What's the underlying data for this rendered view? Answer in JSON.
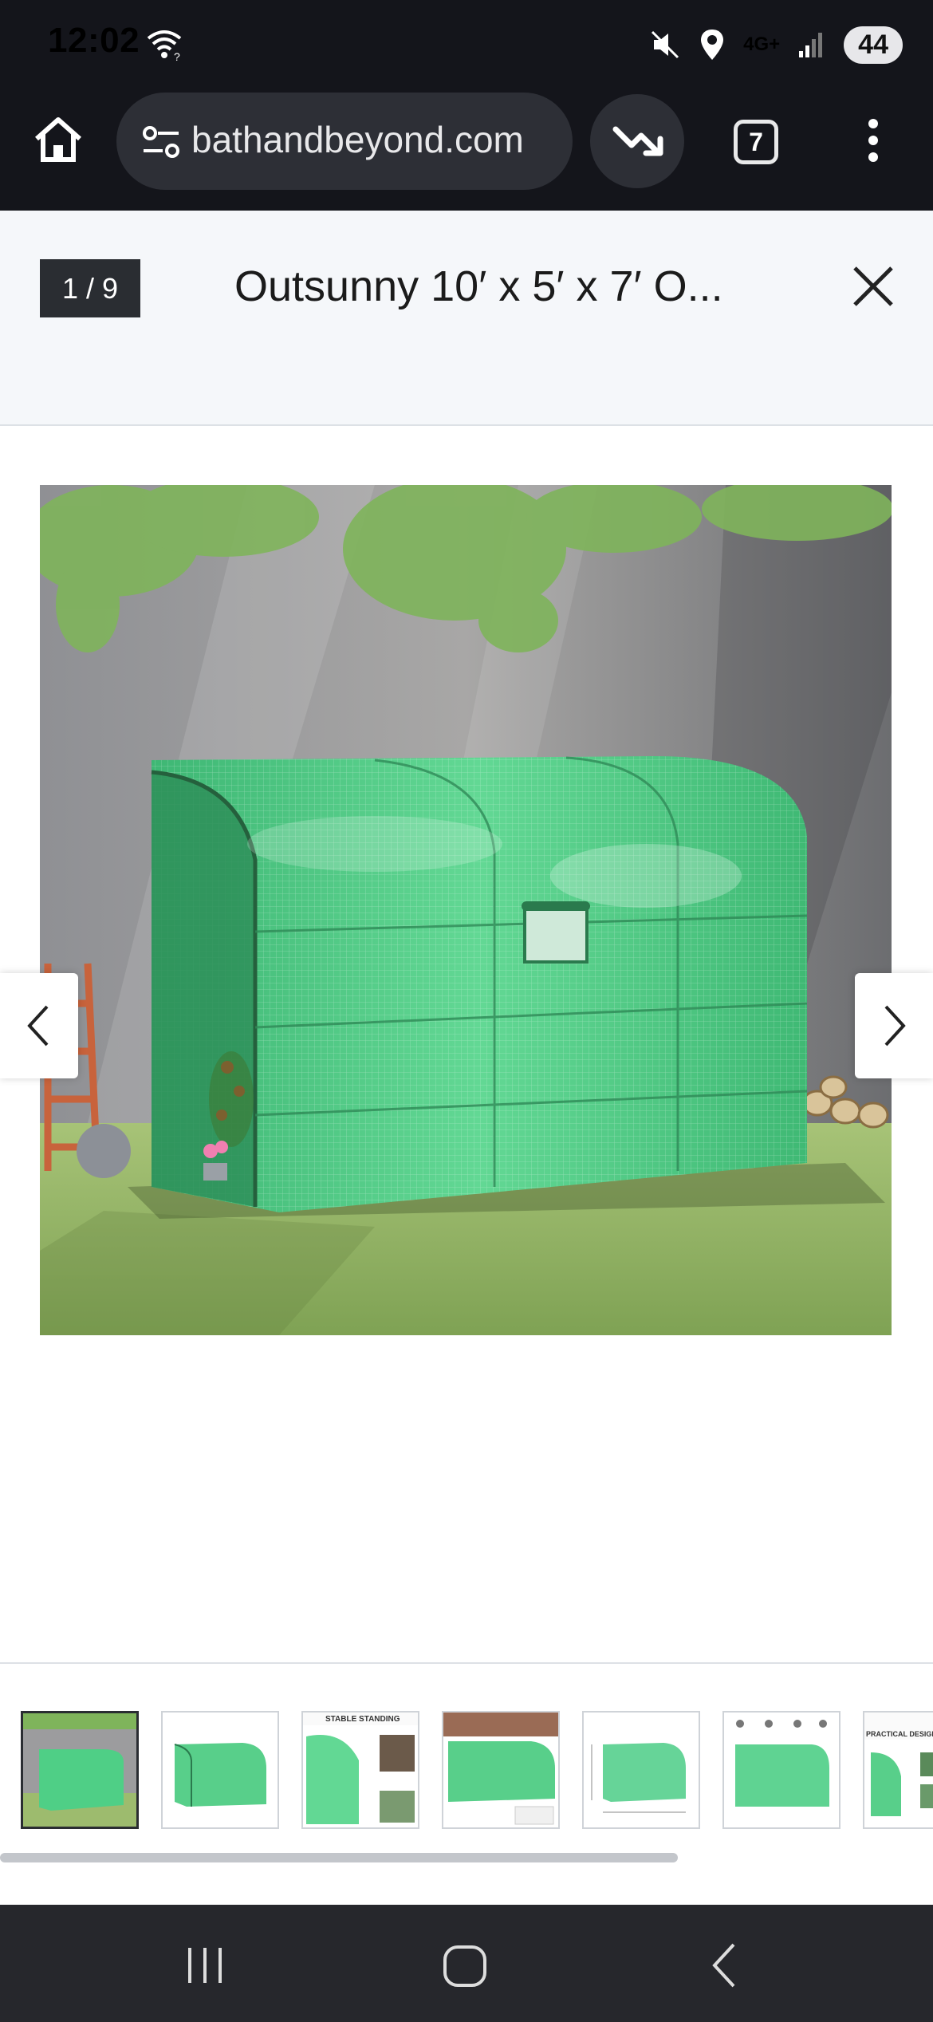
{
  "status_bar": {
    "time": "12:02",
    "network": "4G+",
    "battery": "44",
    "icons": [
      "wifi-icon",
      "mute-icon",
      "location-icon",
      "signal-icon"
    ]
  },
  "browser": {
    "url": "bathandbeyond.com",
    "tab_count": "7",
    "icons": [
      "home-icon",
      "site-settings-icon",
      "trending-down-icon",
      "more-vert-icon"
    ]
  },
  "viewer": {
    "counter": "1 / 9",
    "title": "Outsunny 10′ x 5′ x 7′ O...",
    "main_image": "green lean-to greenhouse in garden",
    "thumbnails": [
      {
        "caption": ""
      },
      {
        "caption": ""
      },
      {
        "caption": "STABLE STANDING"
      },
      {
        "caption": ""
      },
      {
        "caption": ""
      },
      {
        "caption": ""
      },
      {
        "caption": "PRACTICAL DESIGN"
      }
    ]
  },
  "colors": {
    "chrome_bg": "#14151b",
    "header_bg": "#f5f7fa",
    "greenhouse": "#4fcf86",
    "navbar_bg": "#26272c"
  }
}
